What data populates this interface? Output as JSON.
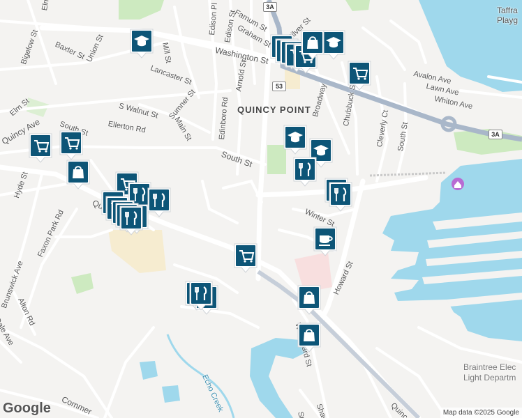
{
  "map": {
    "colors": {
      "land": "#f4f3f1",
      "water": "#9fd8ec",
      "park": "#cdeac0",
      "road": "#ffffff",
      "highway": "#a9b7c9",
      "pin": "#0d5577"
    },
    "labels": [
      {
        "text": "Elm St"
      },
      {
        "text": "Bigelow St"
      },
      {
        "text": "Baxter St"
      },
      {
        "text": "Union St"
      },
      {
        "text": "Mill St"
      },
      {
        "text": "Edison Pl"
      },
      {
        "text": "Edison St"
      },
      {
        "text": "Farnum St"
      },
      {
        "text": "Graham St"
      },
      {
        "text": "Silver St"
      },
      {
        "text": "Taffra"
      },
      {
        "text": "Playg"
      },
      {
        "text": "Washington St"
      },
      {
        "text": "Lancaster St"
      },
      {
        "text": "Avalon Ave"
      },
      {
        "text": "Lawn Ave"
      },
      {
        "text": "Whiton Ave"
      },
      {
        "text": "Arnold St"
      },
      {
        "text": "Sumner St"
      },
      {
        "text": "QUINCY POINT"
      },
      {
        "text": "Broadway"
      },
      {
        "text": "Chubbuck St"
      },
      {
        "text": "Cleverly Ct"
      },
      {
        "text": "South St"
      },
      {
        "text": "Elm St"
      },
      {
        "text": "S Walnut St"
      },
      {
        "text": "Main St"
      },
      {
        "text": "Edinboro Rd"
      },
      {
        "text": "Ellerton Rd"
      },
      {
        "text": "South St"
      },
      {
        "text": "Quincy Ave"
      },
      {
        "text": "South St"
      },
      {
        "text": "Hyde St"
      },
      {
        "text": "Quincy Ave"
      },
      {
        "text": "Faxon Park Rd"
      },
      {
        "text": "Winter St"
      },
      {
        "text": "Howard St"
      },
      {
        "text": "W Howard St"
      },
      {
        "text": "Alton Rd"
      },
      {
        "text": "Dale Ave"
      },
      {
        "text": "Brunswick Ave"
      },
      {
        "text": "Echo Creek"
      },
      {
        "text": "Commer"
      },
      {
        "text": "Shaw"
      },
      {
        "text": "Quinc"
      },
      {
        "text": "Braintree Elec"
      },
      {
        "text": "Light Departm"
      },
      {
        "text": "St"
      }
    ],
    "shields": [
      {
        "text": "3A"
      },
      {
        "text": "53"
      },
      {
        "text": "3A"
      }
    ],
    "pins": [
      {
        "icon": "school-icon"
      },
      {
        "icon": "shopping-bag-icon"
      },
      {
        "icon": "shopping-cart-icon"
      },
      {
        "icon": "school-icon"
      },
      {
        "icon": "shopping-cart-icon"
      },
      {
        "icon": "shopping-cart-icon"
      },
      {
        "icon": "shopping-cart-icon"
      },
      {
        "icon": "shopping-cart-icon"
      },
      {
        "icon": "shopping-cart-icon"
      },
      {
        "icon": "shopping-bag-icon"
      },
      {
        "icon": "school-icon"
      },
      {
        "icon": "school-icon"
      },
      {
        "icon": "restaurant-icon"
      },
      {
        "icon": "shopping-cart-icon"
      },
      {
        "icon": "restaurant-icon"
      },
      {
        "icon": "restaurant-icon"
      },
      {
        "icon": "shopping-cart-icon"
      },
      {
        "icon": "restaurant-icon"
      },
      {
        "icon": "restaurant-icon"
      },
      {
        "icon": "restaurant-icon"
      },
      {
        "icon": "coffee-icon"
      },
      {
        "icon": "shopping-cart-icon"
      },
      {
        "icon": "restaurant-icon"
      },
      {
        "icon": "shopping-bag-icon"
      },
      {
        "icon": "shopping-bag-icon"
      },
      {
        "icon": "shopping-bag-icon"
      }
    ],
    "footer": {
      "logo": "Google",
      "attribution": "Map data ©2025 Google"
    }
  }
}
